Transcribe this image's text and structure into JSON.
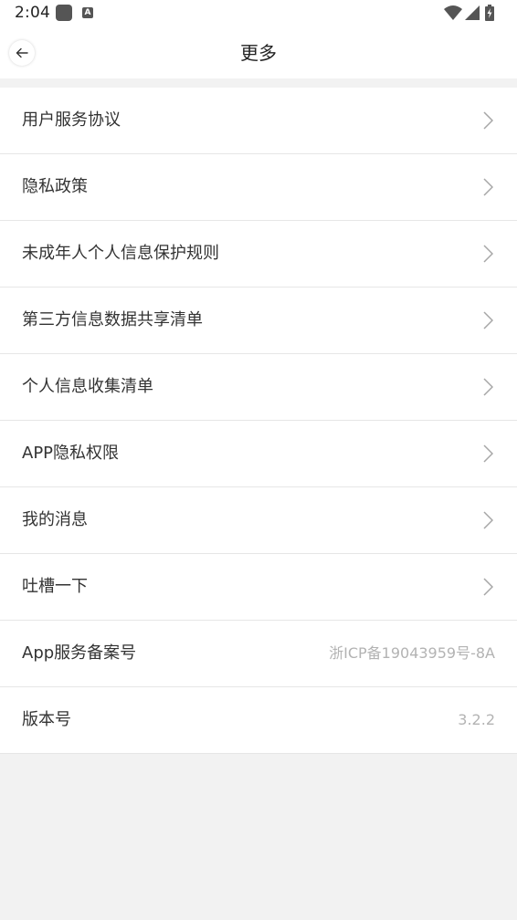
{
  "status_bar": {
    "time": "2:04",
    "icons": [
      "app-notification-icon",
      "a-badge-icon",
      "wifi-icon",
      "signal-icon",
      "battery-charging-icon"
    ],
    "a_badge": "A"
  },
  "header": {
    "title": "更多",
    "back_icon": "arrow-left-icon"
  },
  "menu": {
    "items": [
      {
        "label": "用户服务协议",
        "type": "link"
      },
      {
        "label": "隐私政策",
        "type": "link"
      },
      {
        "label": "未成年人个人信息保护规则",
        "type": "link"
      },
      {
        "label": "第三方信息数据共享清单",
        "type": "link"
      },
      {
        "label": "个人信息收集清单",
        "type": "link"
      },
      {
        "label": "APP隐私权限",
        "type": "link"
      },
      {
        "label": "我的消息",
        "type": "link"
      },
      {
        "label": "吐槽一下",
        "type": "link"
      },
      {
        "label": "App服务备案号",
        "type": "value",
        "value": "浙ICP备19043959号-8A"
      },
      {
        "label": "版本号",
        "type": "value",
        "value": "3.2.2"
      }
    ]
  },
  "colors": {
    "background": "#f2f2f2",
    "surface": "#ffffff",
    "text_primary": "#333333",
    "text_secondary": "#b3b3b3",
    "divider": "#e6e6e6"
  }
}
